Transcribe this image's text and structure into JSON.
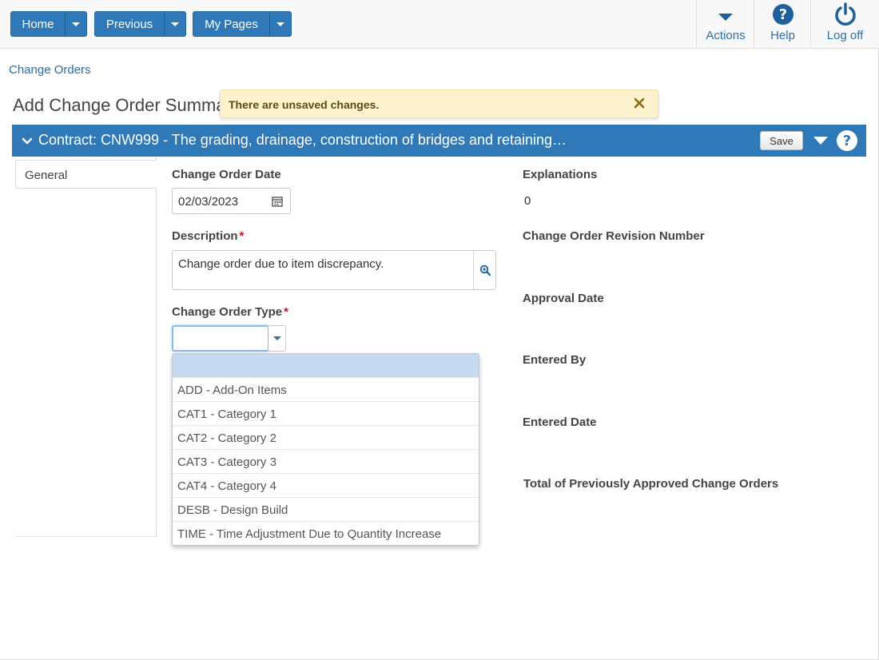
{
  "topnav": {
    "home_label": "Home",
    "previous_label": "Previous",
    "mypages_label": "My Pages"
  },
  "toolbar": {
    "actions_label": "Actions",
    "help_label": "Help",
    "logoff_label": "Log off"
  },
  "breadcrumb": "Change Orders",
  "page_title": "Add Change Order Summary",
  "notification": {
    "message": "There are unsaved changes."
  },
  "panel": {
    "title": "Contract: CNW999 - The grading, drainage, construction of bridges and retaining…",
    "save_label": "Save"
  },
  "tabs": {
    "general": "General"
  },
  "form": {
    "date_label": "Change Order Date",
    "date_value": "02/03/2023",
    "description_label": "Description",
    "description_value": "Change order due to item discrepancy.",
    "type_label": "Change Order Type",
    "type_value": "",
    "required_mark": "*"
  },
  "type_options": [
    "",
    "ADD - Add-On Items",
    "CAT1 - Category 1",
    "CAT2 - Category 2",
    "CAT3 - Category 3",
    "CAT4 - Category 4",
    "DESB - Design Build",
    "TIME - Time Adjustment Due to Quantity Increase"
  ],
  "info": {
    "explanations_label": "Explanations",
    "explanations_value": "0",
    "revision_label": "Change Order Revision Number",
    "approval_label": "Approval Date",
    "entered_by_label": "Entered By",
    "entered_date_label": "Entered Date",
    "total_label": "Total of Previously Approved Change Orders"
  },
  "colors": {
    "primary": "#2f79b9",
    "link": "#2a6cab",
    "warning_bg": "#fcf3ce",
    "required": "#c9111e",
    "selected_option": "#c4daf0"
  },
  "icons": [
    "chevron-down-icon",
    "help-icon",
    "power-icon",
    "close-icon",
    "calendar-icon",
    "zoom-icon"
  ]
}
